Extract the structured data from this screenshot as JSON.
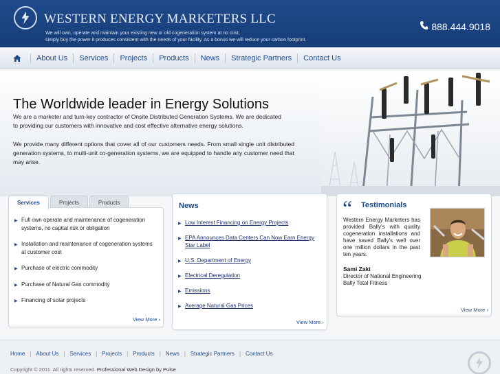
{
  "header": {
    "company": "WESTERN ENERGY MARKETERS LLC",
    "tagline_1": "We will own, operate and maintain your existing new or old cogeneration system at no cost,",
    "tagline_2": "simply buy the power it produces consistent with the needs of your facility. As a bonus we will reduce your carbon footprint.",
    "phone": "888.444.9018"
  },
  "nav": {
    "items": [
      "About Us",
      "Services",
      "Projects",
      "Products",
      "News",
      "Strategic Partners",
      "Contact Us"
    ]
  },
  "hero": {
    "title": "The Worldwide leader in Energy Solutions",
    "paragraph_1": "We are a marketer and turn-key contractor of Onsite Distributed Generation Systems. We are dedicated to providing our customers with innovative and cost effective alternative energy solutions.",
    "paragraph_2": "We provide many different options that cover all of our customers needs. From small single unit distributed generation systems, to multi-unit co-generation systems, we are equipped to handle any customer need that may arise."
  },
  "services_box": {
    "tabs": [
      "Services",
      "Projects",
      "Products"
    ],
    "active_tab": "Services",
    "items": [
      "Full own operate and maintenance of cogeneration systems, no capital risk or obligation",
      "Installation and maintenance of cogeneration systems at customer cost",
      "Purchase of electric commodity",
      "Purchase of Natural Gas commodity",
      "Financing of solar projects"
    ],
    "view_more": "View More ›"
  },
  "news_box": {
    "title": "News",
    "items": [
      "Low Interest Financing on Energy Projects",
      "EPA Announces Data Centers Can Now Earn Energy Star Label",
      "U.S. Department of Energy",
      "Electrical Deregulation",
      "Emissions",
      "Average Natural Gas Prices"
    ],
    "view_more": "View More ›"
  },
  "testimonials_box": {
    "title": "Testimonials",
    "text": "Western Energy Marketers has provided Bally's with quality cogeneration installations and have saved Bally's well over one million dollars in the past ten years.",
    "name": "Sami Zaki",
    "role": "Director of National Engineering Bally Total Fitness",
    "view_more": "View More ›"
  },
  "footer": {
    "nav": [
      "Home",
      "About Us",
      "Services",
      "Projects",
      "Products",
      "News",
      "Strategic Partners",
      "Contact Us"
    ],
    "copyright": "Copyright © 2011. All rights reserved.",
    "credit": "Professional Web Design by Pulse"
  },
  "icons": {
    "logo": "lightning-circle-icon",
    "phone": "phone-icon",
    "home": "home-icon",
    "bullet": "triangle-bullet-icon",
    "quote": "quote-icon"
  },
  "colors": {
    "brand_blue": "#1f4a8c",
    "nav_text": "#1f4a8c",
    "link": "#1f2f6e"
  }
}
